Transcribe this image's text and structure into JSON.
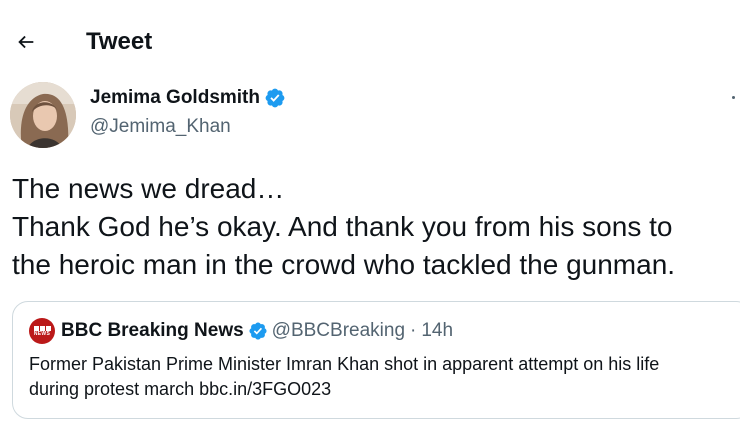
{
  "header": {
    "title": "Tweet"
  },
  "author": {
    "name": "Jemima Goldsmith",
    "handle": "@Jemima_Khan",
    "verified": true
  },
  "tweet": {
    "lines": [
      "The news we dread…",
      "Thank God he’s okay. And thank you from his sons to",
      "the heroic man in the crowd who tackled the gunman."
    ]
  },
  "quoted_tweet": {
    "name": "BBC Breaking News",
    "handle": "@BBCBreaking",
    "separator": "·",
    "time": "14h",
    "verified": true,
    "body_lines": [
      "Former Pakistan Prime Minister Imran Khan shot in apparent attempt on his life",
      "during protest march bbc.in/3FGO023"
    ]
  },
  "colors": {
    "text_primary": "#0f1419",
    "text_secondary": "#536471",
    "verified_blue": "#1d9bf0",
    "border": "#cfd9de",
    "bbc_red": "#bb1919"
  },
  "icons": {
    "back": "arrow-left-icon",
    "verified": "verified-badge-icon",
    "more": "more-icon"
  }
}
